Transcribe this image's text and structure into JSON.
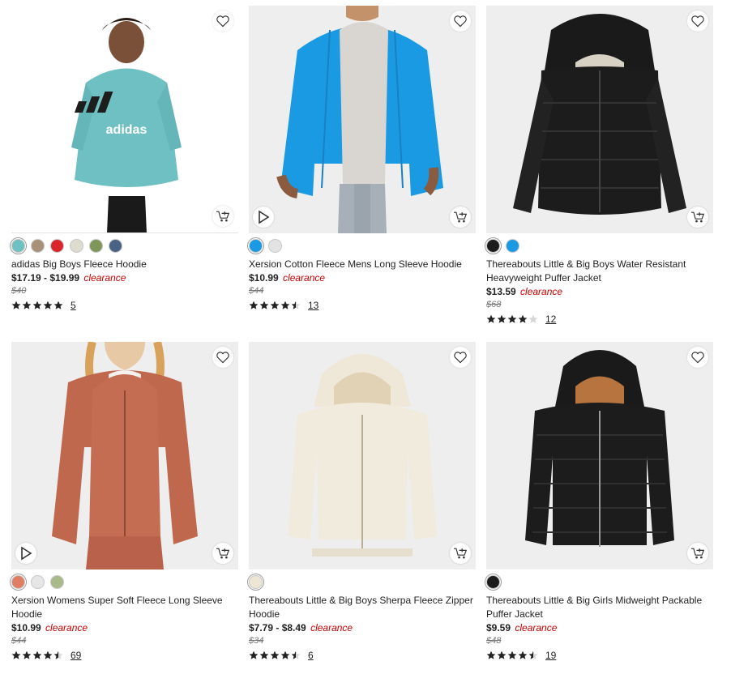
{
  "products": [
    {
      "title": "adidas Big Boys Fleece Hoodie",
      "price": "$17.19 - $19.99",
      "badge": "clearance",
      "original_price": "$40",
      "rating": 5,
      "review_count": "5",
      "swatch_colors": [
        "#6fc0c2",
        "#a89178",
        "#d9252a",
        "#dedbcf",
        "#7f965a",
        "#4a6284"
      ],
      "has_video": false
    },
    {
      "title": "Xersion Cotton Fleece Mens Long Sleeve Hoodie",
      "price": "$10.99",
      "badge": "clearance",
      "original_price": "$44",
      "rating": 4.5,
      "review_count": "13",
      "swatch_colors": [
        "#1b9ae4",
        "#e3e3e3"
      ],
      "has_video": true
    },
    {
      "title": "Thereabouts Little & Big Boys Water Resistant Heavyweight Puffer Jacket",
      "price": "$13.59",
      "badge": "clearance",
      "original_price": "$68",
      "rating": 4,
      "review_count": "12",
      "swatch_colors": [
        "#1c1c1c",
        "#1b9ae4"
      ],
      "has_video": false
    },
    {
      "title": "Xersion Womens Super Soft Fleece Long Sleeve Hoodie",
      "price": "$10.99",
      "badge": "clearance",
      "original_price": "$44",
      "rating": 4.5,
      "review_count": "69",
      "swatch_colors": [
        "#de7f65",
        "#e6e6e6",
        "#a9b98a"
      ],
      "has_video": true
    },
    {
      "title": "Thereabouts Little & Big Boys Sherpa Fleece Zipper Hoodie",
      "price": "$7.79 - $8.49",
      "badge": "clearance",
      "original_price": "$34",
      "rating": 4.5,
      "review_count": "6",
      "swatch_colors": [
        "#ede6d5"
      ],
      "has_video": false
    },
    {
      "title": "Thereabouts Little & Big Girls Midweight Packable Puffer Jacket",
      "price": "$9.59",
      "badge": "clearance",
      "original_price": "$48",
      "rating": 4.5,
      "review_count": "19",
      "swatch_colors": [
        "#1c1c1c"
      ],
      "has_video": false
    }
  ],
  "icons": {
    "favorite": "heart-outline-icon",
    "add_to_cart": "cart-plus-icon",
    "video": "play-icon",
    "star": "star-icon"
  },
  "colors": {
    "clearance": "#cc0000",
    "star": "#222222"
  }
}
